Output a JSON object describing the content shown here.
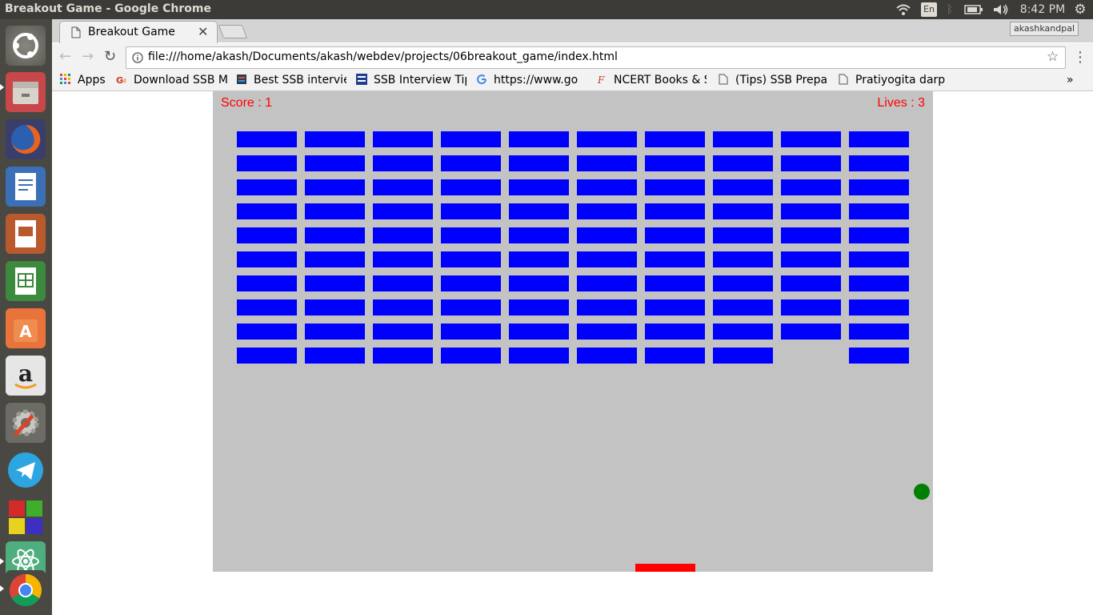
{
  "system": {
    "window_title": "Breakout Game - Google Chrome",
    "keyboard_layout": "En",
    "clock": "8:42 PM"
  },
  "browser": {
    "tab_title": "Breakout Game",
    "tab_close": "✕",
    "profile_name": "akashkandpal",
    "url": "file:///home/akash/Documents/akash/webdev/projects/06breakout_game/index.html",
    "bookmarks": [
      {
        "label": "Apps",
        "icon": "apps-grid-icon"
      },
      {
        "label": "Download SSB M",
        "icon": "gm-icon"
      },
      {
        "label": "Best SSB intervie",
        "icon": "book-icon"
      },
      {
        "label": "SSB Interview Tip",
        "icon": "ssb-tips-icon"
      },
      {
        "label": "https://www.go",
        "icon": "google-icon"
      },
      {
        "label": "NCERT Books & S",
        "icon": "ncert-icon"
      },
      {
        "label": "(Tips) SSB Prepar",
        "icon": "page-icon"
      },
      {
        "label": "Pratiyogita darp",
        "icon": "page-icon"
      }
    ],
    "more_bookmarks": "»"
  },
  "game": {
    "score_label": "Score : 1",
    "lives_label": "Lives : 3",
    "colors": {
      "brick": "#0000ff",
      "ball": "#008000",
      "paddle": "#ff0000",
      "background": "#c3c3c3",
      "hud": "#ff0000"
    },
    "brick_grid": {
      "rows": 10,
      "columns": 10,
      "destroyed": [
        {
          "row": 9,
          "col": 8
        }
      ]
    }
  },
  "launcher_icons": [
    "ubuntu-dash-icon",
    "files-icon",
    "firefox-icon",
    "writer-icon",
    "impress-icon",
    "calc-icon",
    "software-center-icon",
    "amazon-icon",
    "system-settings-icon",
    "telegram-icon",
    "game-icon",
    "atom-icon",
    "chrome-icon"
  ]
}
